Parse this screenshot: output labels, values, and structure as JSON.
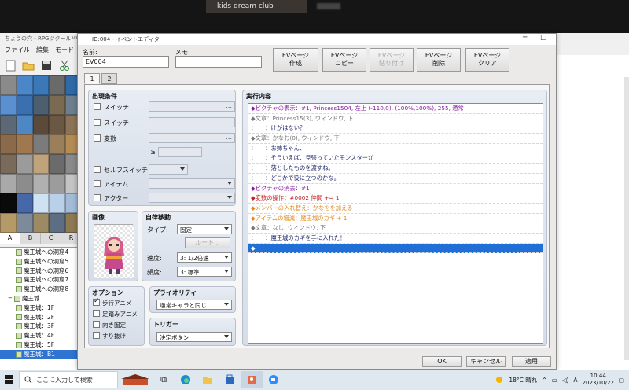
{
  "overlay": {
    "label": "kids dream club"
  },
  "app": {
    "title": "ちょうの穴 - RPGツクールMV",
    "menu": [
      "ファイル",
      "編集",
      "モード"
    ]
  },
  "tileset_tabs": [
    "A",
    "B",
    "C",
    "R"
  ],
  "map_tree": [
    {
      "label": "魔王城への洞窟4",
      "indent": 2
    },
    {
      "label": "魔王城への洞窟5",
      "indent": 2
    },
    {
      "label": "魔王城への洞窟6",
      "indent": 2
    },
    {
      "label": "魔王城への洞窟7",
      "indent": 2
    },
    {
      "label": "魔王城への洞窟8",
      "indent": 2
    },
    {
      "label": "魔王城",
      "indent": 1,
      "expander": "−"
    },
    {
      "label": "魔王城：1F",
      "indent": 2
    },
    {
      "label": "魔王城：2F",
      "indent": 2
    },
    {
      "label": "魔王城：3F",
      "indent": 2
    },
    {
      "label": "魔王城：4F",
      "indent": 2
    },
    {
      "label": "魔王城：5F",
      "indent": 2
    },
    {
      "label": "魔王城：B1",
      "indent": 2,
      "selected": true
    }
  ],
  "dialog": {
    "title": "ID:004 - イベントエディター",
    "name_label": "名前:",
    "name_value": "EV004",
    "memo_label": "メモ:",
    "memo_value": "",
    "page_buttons": [
      {
        "line1": "EVページ",
        "line2": "作成",
        "enabled": true
      },
      {
        "line1": "EVページ",
        "line2": "コピー",
        "enabled": true
      },
      {
        "line1": "EVページ",
        "line2": "貼り付け",
        "enabled": false
      },
      {
        "line1": "EVページ",
        "line2": "削除",
        "enabled": true
      },
      {
        "line1": "EVページ",
        "line2": "クリア",
        "enabled": true
      }
    ],
    "tabs": [
      "1",
      "2"
    ],
    "conditions": {
      "title": "出現条件",
      "switch1": "スイッチ",
      "switch2": "スイッチ",
      "variable": "変数",
      "gte": "≥",
      "self_switch": "セルフスイッチ",
      "item": "アイテム",
      "actor": "アクター",
      "dots": "..."
    },
    "image": {
      "title": "画像"
    },
    "autonomous": {
      "title": "自律移動",
      "type_label": "タイプ:",
      "type_value": "固定",
      "route_button": "ルート...",
      "speed_label": "速度:",
      "speed_value": "3: 1/2倍速",
      "freq_label": "頻度:",
      "freq_value": "3: 標準"
    },
    "options": {
      "title": "オプション",
      "items": [
        {
          "label": "歩行アニメ",
          "checked": true
        },
        {
          "label": "足踏みアニメ",
          "checked": false
        },
        {
          "label": "向き固定",
          "checked": false
        },
        {
          "label": "すり抜け",
          "checked": false
        }
      ]
    },
    "priority": {
      "title": "プライオリティ",
      "value": "通常キャラと同じ"
    },
    "trigger": {
      "title": "トリガー",
      "value": "決定ボタン"
    },
    "contents": {
      "title": "実行内容",
      "commands": [
        {
          "text": "◆ピクチャの表示：#1, Princess1504, 左上 (-110,0), (100%,100%), 255, 通常",
          "color": "purple"
        },
        {
          "text": "◆文章：Princess15(3), ウィンドウ, 下",
          "color": "gray"
        },
        {
          "text": "：　　：けがはない？",
          "color": "navy"
        },
        {
          "text": "◆文章：かなお(0), ウィンドウ, 下",
          "color": "gray"
        },
        {
          "text": "：　　：お姉ちゃん、",
          "color": "navy"
        },
        {
          "text": "：　　：そういえば、見張っていたモンスターが",
          "color": "navy"
        },
        {
          "text": "：　　：落としたものを渡すね。",
          "color": "navy"
        },
        {
          "text": "：　　：どこかで役に立つのかな。",
          "color": "navy"
        },
        {
          "text": "◆ピクチャの消去：#1",
          "color": "purple"
        },
        {
          "text": "◆変数の操作：#0002 仲間 += 1",
          "color": "red"
        },
        {
          "text": "◆メンバーの入れ替え：かなをを加える",
          "color": "orange"
        },
        {
          "text": "◆アイテムの増減：魔王城のカギ + 1",
          "color": "orange"
        },
        {
          "text": "◆文章：なし, ウィンドウ, 下",
          "color": "gray"
        },
        {
          "text": "：　　：魔王城のカギを手に入れた！",
          "color": "navy"
        },
        {
          "text": "◆",
          "color": "white",
          "selected": true
        }
      ]
    },
    "ok": "OK",
    "cancel": "キャンセル",
    "apply": "適用"
  },
  "taskbar": {
    "search_placeholder": "ここに入力して検索",
    "weather": "18°C 晴れ",
    "ime": "A",
    "time": "10:44",
    "date": "2023/10/22"
  }
}
